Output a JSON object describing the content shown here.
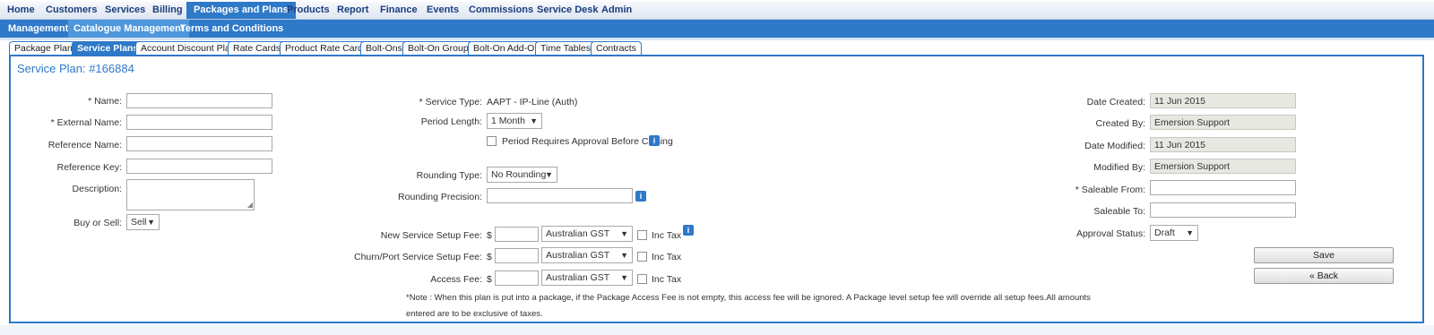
{
  "topnav": {
    "items": [
      "Home",
      "Customers",
      "Services",
      "Billing",
      "Packages and Plans",
      "Products",
      "Report",
      "Finance",
      "Events",
      "Commissions",
      "Service Desk",
      "Admin"
    ]
  },
  "subnav": {
    "items": [
      "Management",
      "Catalogue Management",
      "Terms and Conditions"
    ]
  },
  "tabs": [
    "Package Plans",
    "Service Plans",
    "Account Discount Plans",
    "Rate Cards",
    "Product Rate Cards",
    "Bolt-Ons",
    "Bolt-On Groups",
    "Bolt-On Add-On",
    "Time Tables",
    "Contracts"
  ],
  "panel": {
    "title": "Service Plan: #166884"
  },
  "left_form": {
    "name_label": "* Name:",
    "name_value": "",
    "external_name_label": "* External Name:",
    "external_name_value": "",
    "reference_name_label": "Reference Name:",
    "reference_name_value": "",
    "reference_key_label": "Reference Key:",
    "reference_key_value": "",
    "description_label": "Description:",
    "buy_or_sell_label": "Buy or Sell:",
    "buy_or_sell_value": "Sell"
  },
  "middle_form": {
    "service_type_label": "* Service Type:",
    "service_type_value": "AAPT - IP-Line (Auth)",
    "period_length_label": "Period Length:",
    "period_length_value": "1 Month",
    "period_approval_label": "Period Requires Approval Before Closing",
    "rounding_type_label": "Rounding Type:",
    "rounding_type_value": "No Rounding",
    "rounding_precision_label": "Rounding Precision:",
    "fees": [
      {
        "label": "New Service Setup Fee:",
        "currency": "$",
        "amount": "",
        "tax": "Australian GST",
        "inc_tax_label": "Inc Tax"
      },
      {
        "label": "Churn/Port Service Setup Fee:",
        "currency": "$",
        "amount": "",
        "tax": "Australian GST",
        "inc_tax_label": "Inc Tax"
      },
      {
        "label": "Access Fee:",
        "currency": "$",
        "amount": "",
        "tax": "Australian GST",
        "inc_tax_label": "Inc Tax"
      }
    ],
    "note_line1": "*Note : When this plan is put into a package, if the Package Access Fee is not empty, this access fee will be ignored. A Package level setup fee will override all setup fees.All amounts",
    "note_line2": "entered are to be exclusive of taxes."
  },
  "right_form": {
    "date_created_label": "Date Created:",
    "date_created_value": "11 Jun 2015",
    "created_by_label": "Created By:",
    "created_by_value": "Emersion Support",
    "date_modified_label": "Date Modified:",
    "date_modified_value": "11 Jun 2015",
    "modified_by_label": "Modified By:",
    "modified_by_value": "Emersion Support",
    "saleable_from_label": "* Saleable From:",
    "saleable_from_value": "",
    "saleable_to_label": "Saleable To:",
    "saleable_to_value": "",
    "approval_status_label": "Approval Status:",
    "approval_status_value": "Draft"
  },
  "actions": {
    "save_label": "Save",
    "back_label": "« Back"
  },
  "icons": {
    "info": "info-icon",
    "dropdown": "chevron-down-icon",
    "resize": "resize-grip-icon"
  },
  "colors": {
    "accent": "#2e79c8",
    "nav_text": "#1a3d7c",
    "readonly_bg": "#e8e8e2"
  }
}
